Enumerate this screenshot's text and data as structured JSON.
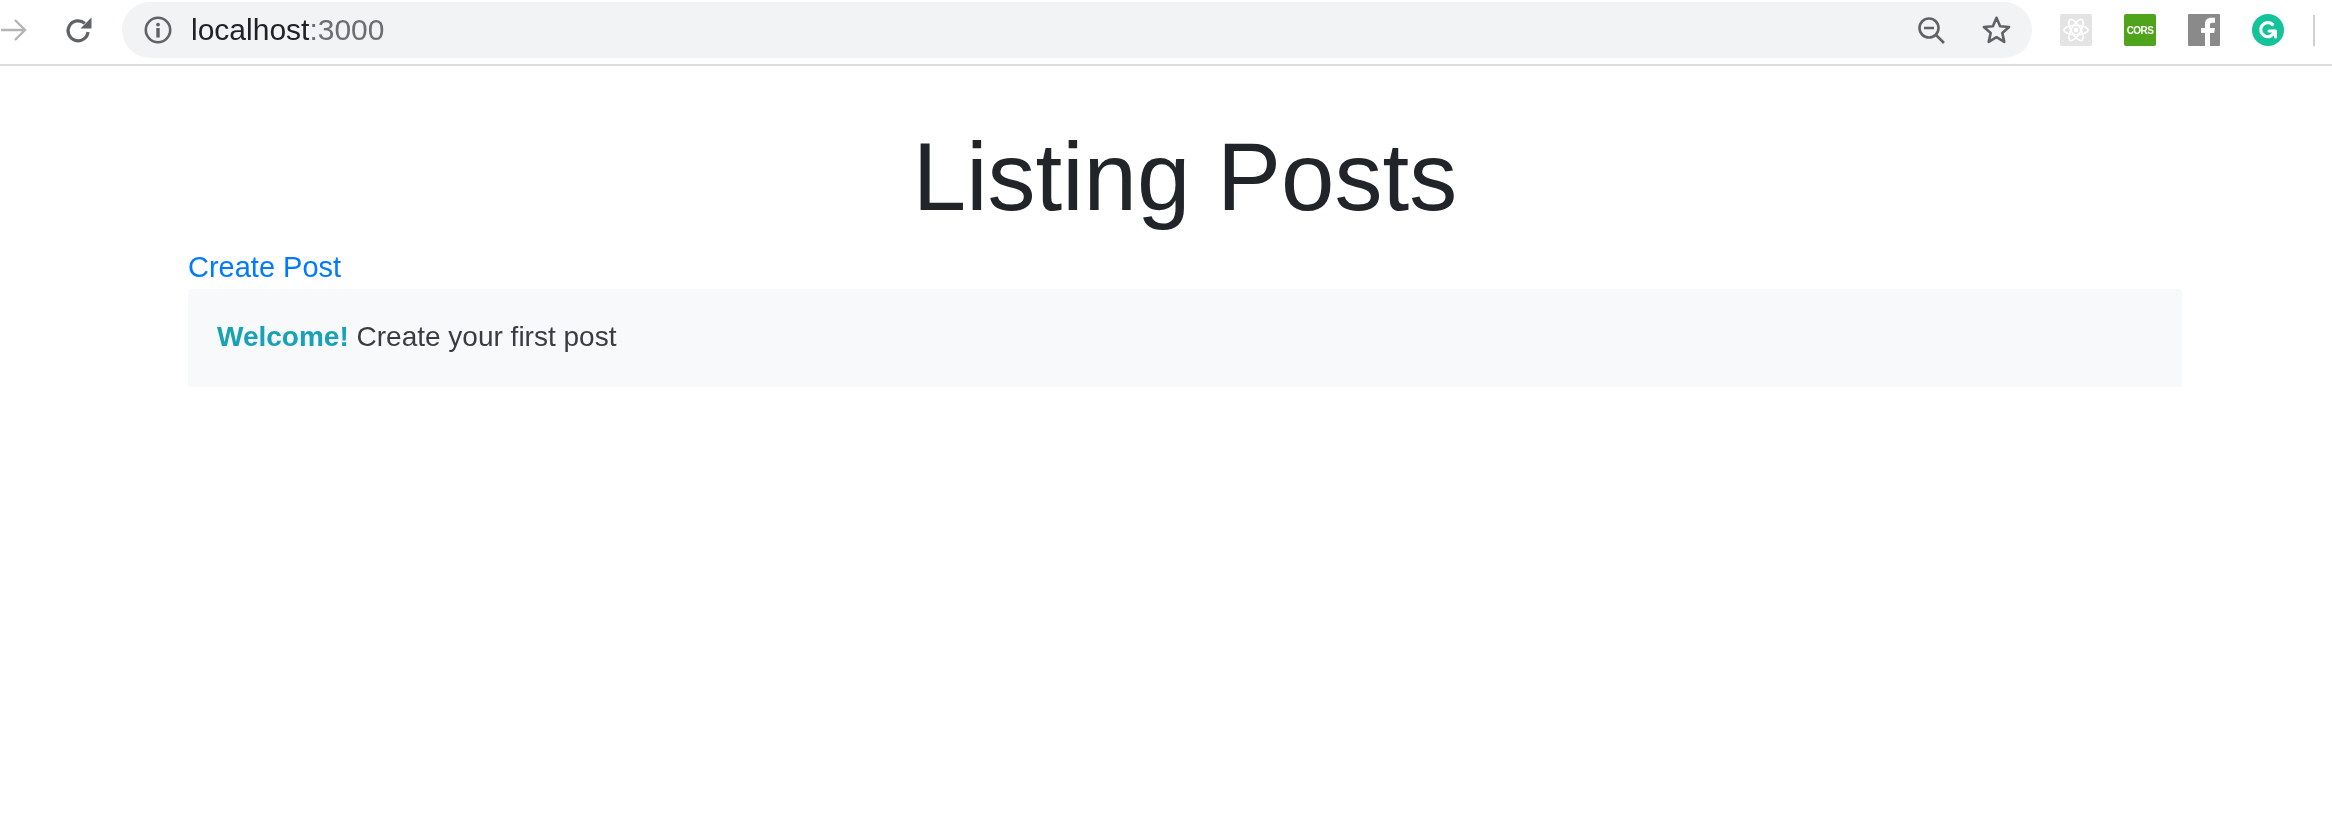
{
  "browser": {
    "nav_buttons": [
      {
        "kind": "forward",
        "disabled": true
      },
      {
        "kind": "reload",
        "disabled": false
      }
    ],
    "address": {
      "host": "localhost",
      "port": ":3000"
    },
    "address_actions": [
      {
        "kind": "zoom_out"
      },
      {
        "kind": "bookmark"
      }
    ],
    "extensions": [
      {
        "kind": "atom"
      },
      {
        "kind": "label",
        "label": "CORS"
      },
      {
        "kind": "letter_f"
      },
      {
        "kind": "circle_arrow"
      }
    ]
  },
  "page": {
    "title": "Listing Posts",
    "create_link": "Create Post",
    "alert": {
      "text": "**Welcome!** Create your first post"
    }
  }
}
